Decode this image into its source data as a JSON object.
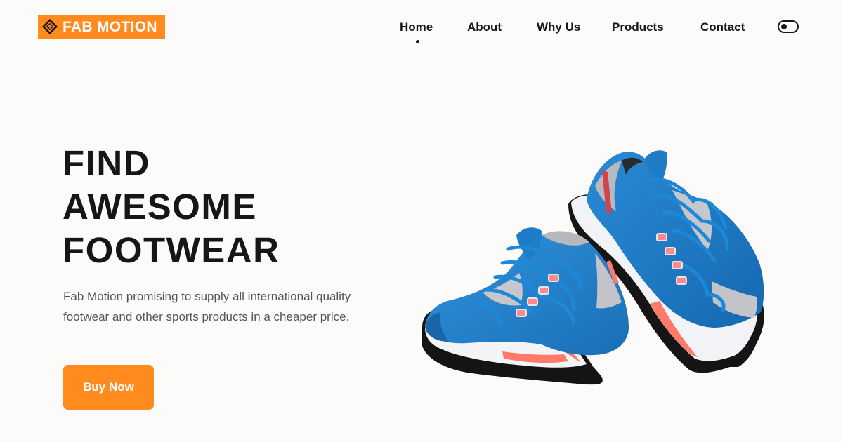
{
  "brand": {
    "name": "FAB MOTION",
    "logo_color": "#ff8a1e",
    "logo_icon": "diamond-logo-icon"
  },
  "nav": {
    "items": [
      {
        "label": "Home",
        "active": true
      },
      {
        "label": "About",
        "active": false
      },
      {
        "label": "Why Us",
        "active": false
      },
      {
        "label": "Products",
        "active": false
      },
      {
        "label": "Contact",
        "active": false
      }
    ],
    "theme_toggle_icon": "toggle-switch-icon"
  },
  "hero": {
    "title_lines": [
      "FIND",
      "AWESOME",
      "FOOTWEAR"
    ],
    "description": "Fab Motion promising to supply all international quality footwear and other sports products in a cheaper price.",
    "cta_label": "Buy Now",
    "image": {
      "subject": "pair of blue running sneakers",
      "primary_color": "#1f7fc8",
      "accent_color": "#ff7a6b"
    }
  },
  "colors": {
    "accent": "#ff8a1e",
    "text": "#161616",
    "muted_text": "#555555",
    "background": "#fcfbf9"
  }
}
